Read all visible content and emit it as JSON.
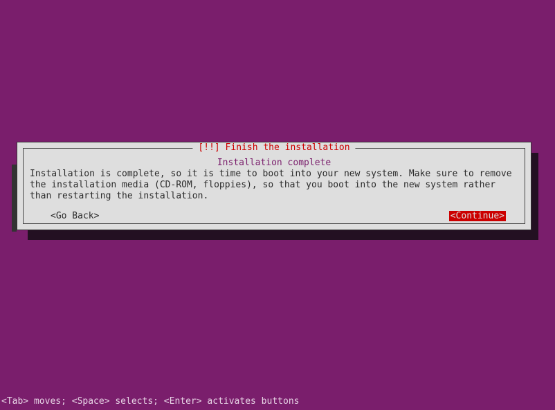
{
  "dialog": {
    "title": "[!!] Finish the installation",
    "subtitle": "Installation complete",
    "body": "Installation is complete, so it is time to boot into your new system. Make sure to remove the installation media (CD-ROM, floppies), so that you boot into the new system rather than restarting the installation.",
    "go_back_label": "<Go Back>",
    "continue_label": "<Continue>"
  },
  "footer": {
    "help_text": "<Tab> moves; <Space> selects; <Enter> activates buttons"
  }
}
